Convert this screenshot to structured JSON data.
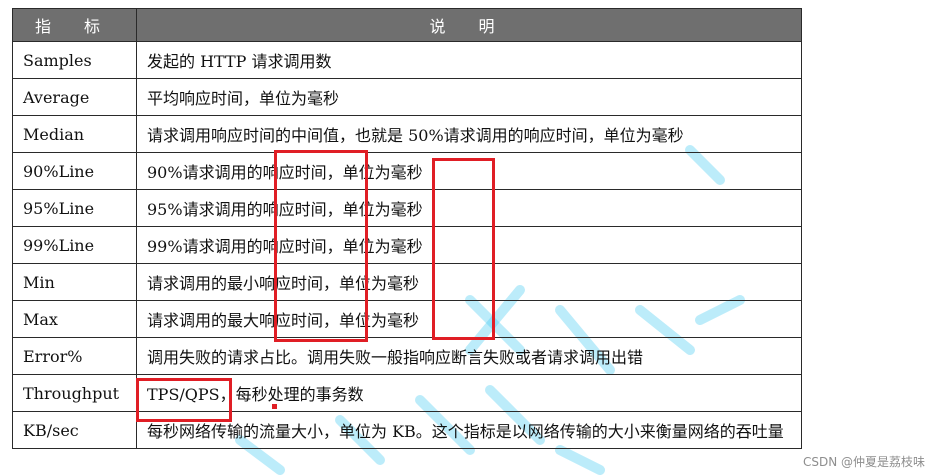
{
  "table": {
    "headers": [
      "指 标",
      "说 明"
    ],
    "rows": [
      {
        "metric": "Samples",
        "description": "发起的 HTTP 请求调用数"
      },
      {
        "metric": "Average",
        "description": "平均响应时间，单位为毫秒"
      },
      {
        "metric": "Median",
        "description": "请求调用响应时间的中间值，也就是 50%请求调用的响应时间，单位为毫秒"
      },
      {
        "metric": "90%Line",
        "description": "90%请求调用的响应时间，单位为毫秒"
      },
      {
        "metric": "95%Line",
        "description": "95%请求调用的响应时间，单位为毫秒"
      },
      {
        "metric": "99%Line",
        "description": "99%请求调用的响应时间，单位为毫秒"
      },
      {
        "metric": "Min",
        "description": "请求调用的最小响应时间，单位为毫秒"
      },
      {
        "metric": "Max",
        "description": "请求调用的最大响应时间，单位为毫秒"
      },
      {
        "metric": "Error%",
        "description": "调用失败的请求占比。调用失败一般指响应断言失败或者请求调用出错"
      },
      {
        "metric": "Throughput",
        "description": "TPS/QPS，每秒处理的事务数"
      },
      {
        "metric": "KB/sec",
        "description": "每秒网络传输的流量大小，单位为 KB。这个指标是以网络传输的大小来衡量网络的吞吐量"
      }
    ]
  },
  "credit": "CSDN @仲夏是荔枝味",
  "colors": {
    "header_bg": "#6f6f6f",
    "annotation": "#e01e25",
    "watermark": "#3ec8f0"
  }
}
